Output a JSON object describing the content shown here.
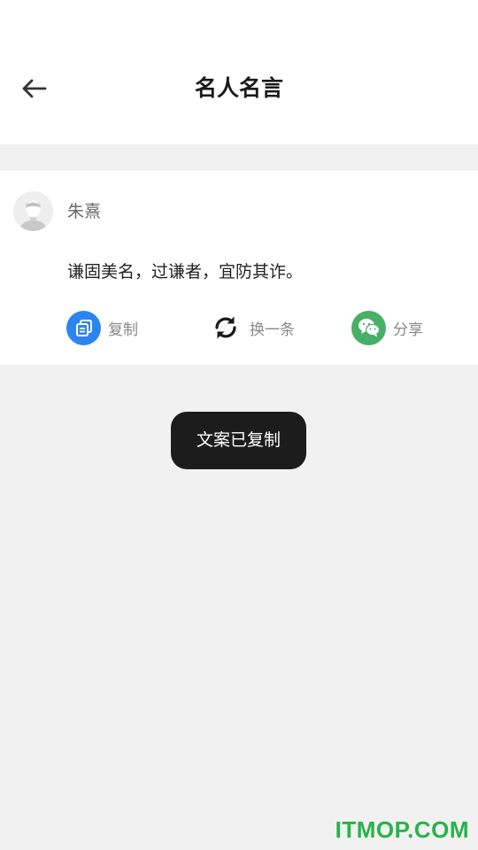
{
  "header": {
    "title": "名人名言",
    "back_icon": "arrow-left-icon"
  },
  "card": {
    "author": "朱熹",
    "avatar_icon": "user-avatar-icon",
    "quote": "谦固美名，过谦者，宜防其诈。",
    "actions": [
      {
        "label": "复制",
        "icon": "copy-icon",
        "color": "#2b85f0"
      },
      {
        "label": "换一条",
        "icon": "refresh-icon",
        "color": "#1a1a1a"
      },
      {
        "label": "分享",
        "icon": "wechat-icon",
        "color": "#47b067"
      }
    ]
  },
  "toast": {
    "message": "文案已复制"
  },
  "watermark": {
    "text": "ITMOP.COM",
    "color": "#29b24a"
  }
}
